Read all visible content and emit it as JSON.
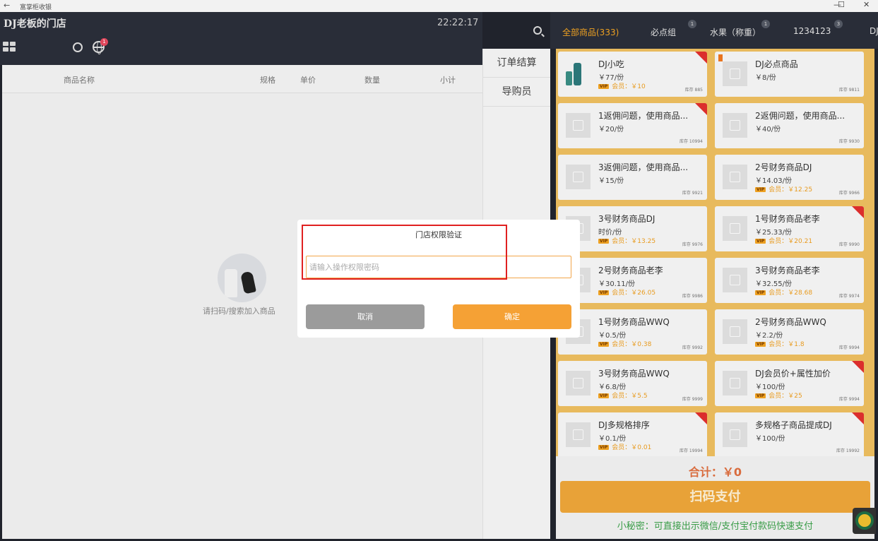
{
  "titlebar": {
    "back": "←",
    "app_title": "富掌柜收银",
    "minimize": "—",
    "maximize": "☐",
    "close": "✕"
  },
  "header": {
    "store_name": "DJ老板的门店",
    "clock": "22:22:17",
    "net_badge": "1"
  },
  "order_table": {
    "columns": [
      "商品名称",
      "规格",
      "单价",
      "数量",
      "小计"
    ],
    "empty_text": "请扫码/搜索加入商品"
  },
  "side_actions": [
    "订单结算",
    "导购员"
  ],
  "categories": [
    {
      "label": "全部商品(333)",
      "badge": ""
    },
    {
      "label": "必点组",
      "badge": "1"
    },
    {
      "label": "水果（称重）",
      "badge": "1"
    },
    {
      "label": "1234123",
      "badge": "3"
    },
    {
      "label": "DJ",
      "badge": ""
    }
  ],
  "products": [
    {
      "name": "DJ小吃",
      "price": "￥77/份",
      "member": "会员：￥10",
      "stock": "库存 885",
      "hot": true,
      "image": true
    },
    {
      "name": "DJ必点商品",
      "price": "￥8/份",
      "member": "",
      "stock": "库存 9811",
      "flag": true
    },
    {
      "name": "1返佣问题，使用商品...",
      "price": "￥20/份",
      "member": "",
      "stock": "库存 10994",
      "hot": true
    },
    {
      "name": "2返佣问题，使用商品...",
      "price": "￥40/份",
      "member": "",
      "stock": "库存 9930"
    },
    {
      "name": "3返佣问题，使用商品...",
      "price": "￥15/份",
      "member": "",
      "stock": "库存 9921"
    },
    {
      "name": "2号财务商品DJ",
      "price": "￥14.03/份",
      "member": "会员：￥12.25",
      "stock": "库存 9966"
    },
    {
      "name": "3号财务商品DJ",
      "price": "时价/份",
      "member": "会员：￥13.25",
      "stock": "库存 9976"
    },
    {
      "name": "1号财务商品老李",
      "price": "￥25.33/份",
      "member": "会员：￥20.21",
      "stock": "库存 9990",
      "hot": true
    },
    {
      "name": "2号财务商品老李",
      "price": "￥30.11/份",
      "member": "会员：￥26.05",
      "stock": "库存 9986"
    },
    {
      "name": "3号财务商品老李",
      "price": "￥32.55/份",
      "member": "会员：￥28.68",
      "stock": "库存 9974"
    },
    {
      "name": "1号财务商品WWQ",
      "price": "￥0.5/份",
      "member": "会员：￥0.38",
      "stock": "库存 9992"
    },
    {
      "name": "2号财务商品WWQ",
      "price": "￥2.2/份",
      "member": "会员：￥1.8",
      "stock": "库存 9994"
    },
    {
      "name": "3号财务商品WWQ",
      "price": "￥6.8/份",
      "member": "会员：￥5.5",
      "stock": "库存 9999"
    },
    {
      "name": "DJ会员价+属性加价",
      "price": "￥100/份",
      "member": "会员：￥25",
      "stock": "库存 9994",
      "hot": true
    },
    {
      "name": "DJ多规格排序",
      "price": "￥0.1/份",
      "member": "会员：￥0.01",
      "stock": "库存 19994",
      "hot": true
    },
    {
      "name": "多规格子商品提成DJ",
      "price": "￥100/份",
      "member": "",
      "stock": "库存 19992",
      "hot": true
    }
  ],
  "vip_tag": "VIP",
  "checkout": {
    "total": "合计：￥0",
    "pay_label": "扫码支付",
    "tip": "小秘密：可直接出示微信/支付宝付款码快速支付"
  },
  "modal": {
    "title": "门店权限验证",
    "input_placeholder": "请输入操作权限密码",
    "input_value": "",
    "cancel_label": "取消",
    "confirm_label": "确定"
  },
  "colors": {
    "accent": "#f5a135",
    "hot_tag": "#e3302f",
    "highlight": "#e02020",
    "tip": "#3ba24a"
  }
}
